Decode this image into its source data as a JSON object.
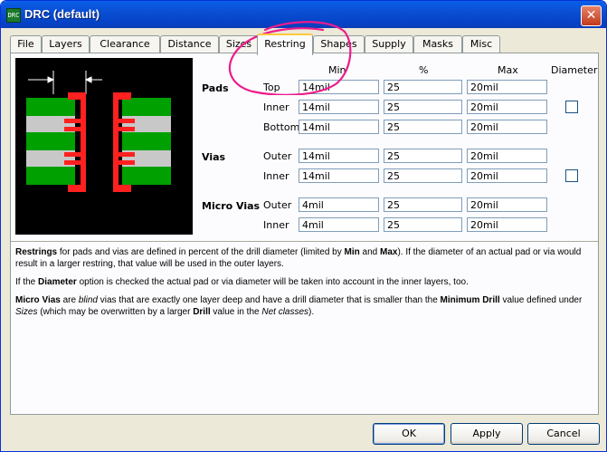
{
  "window": {
    "title": "DRC (default)",
    "app_icon": "eagle-app-icon",
    "close_label": "✕"
  },
  "tabs": [
    "File",
    "Layers",
    "Clearance",
    "Distance",
    "Sizes",
    "Restring",
    "Shapes",
    "Supply",
    "Masks",
    "Misc"
  ],
  "active_tab": "Restring",
  "columns": {
    "min": "Min",
    "percent": "%",
    "max": "Max",
    "diameter": "Diameter"
  },
  "groups": {
    "pads": {
      "label": "Pads",
      "rows": [
        {
          "label": "Top",
          "min": "14mil",
          "percent": "25",
          "max": "20mil"
        },
        {
          "label": "Inner",
          "min": "14mil",
          "percent": "25",
          "max": "20mil",
          "diameter_checked": false
        },
        {
          "label": "Bottom",
          "min": "14mil",
          "percent": "25",
          "max": "20mil"
        }
      ]
    },
    "vias": {
      "label": "Vias",
      "rows": [
        {
          "label": "Outer",
          "min": "14mil",
          "percent": "25",
          "max": "20mil"
        },
        {
          "label": "Inner",
          "min": "14mil",
          "percent": "25",
          "max": "20mil",
          "diameter_checked": false
        }
      ]
    },
    "micro_vias": {
      "label": "Micro Vias",
      "rows": [
        {
          "label": "Outer",
          "min": "4mil",
          "percent": "25",
          "max": "20mil"
        },
        {
          "label": "Inner",
          "min": "4mil",
          "percent": "25",
          "max": "20mil"
        }
      ]
    }
  },
  "description": {
    "p1": [
      {
        "t": "Restrings",
        "b": true
      },
      {
        "t": " for pads and vias are defined in percent of the drill diameter (limited by "
      },
      {
        "t": "Min",
        "b": true
      },
      {
        "t": " and "
      },
      {
        "t": "Max",
        "b": true
      },
      {
        "t": "). If the diameter of an actual pad or via would result in a larger restring, that value will be used in the outer layers."
      }
    ],
    "p2": [
      {
        "t": "If the "
      },
      {
        "t": "Diameter",
        "b": true
      },
      {
        "t": " option is checked the actual pad or via diameter will be taken into account in the inner layers, too."
      }
    ],
    "p3": [
      {
        "t": "Micro Vias",
        "b": true
      },
      {
        "t": " are "
      },
      {
        "t": "blind",
        "i": true
      },
      {
        "t": " vias that are exactly one layer deep and have a drill diameter that is smaller than the "
      },
      {
        "t": "Minimum Drill",
        "b": true
      },
      {
        "t": " value defined under "
      },
      {
        "t": "Sizes",
        "i": true
      },
      {
        "t": " (which may be overwritten by a larger "
      },
      {
        "t": "Drill",
        "b": true
      },
      {
        "t": " value in the "
      },
      {
        "t": "Net classes",
        "i": true
      },
      {
        "t": ")."
      }
    ]
  },
  "buttons": {
    "ok": "OK",
    "apply": "Apply",
    "cancel": "Cancel"
  },
  "colors": {
    "copper": "#00a000",
    "restring": "#ff2020",
    "dielectric": "#c8c8c8",
    "annotation": "#ec1c8c"
  }
}
